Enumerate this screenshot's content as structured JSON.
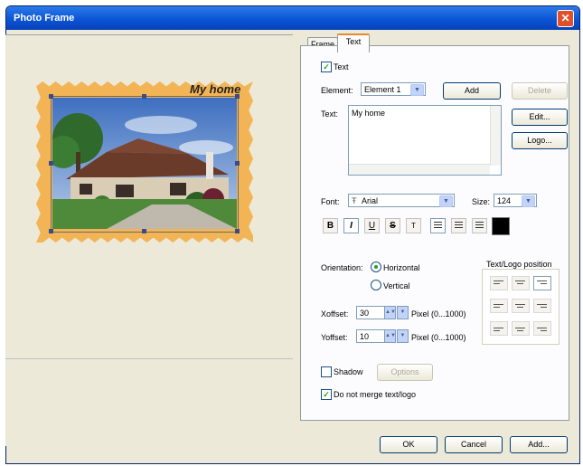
{
  "window": {
    "title": "Photo Frame"
  },
  "tabs": [
    {
      "label": "Frame"
    },
    {
      "label": "Text"
    }
  ],
  "text_tab": {
    "text_checkbox": "Text",
    "element_label": "Element:",
    "element_value": "Element 1",
    "add_label": "Add",
    "delete_label": "Delete",
    "text_label": "Text:",
    "text_value": "My home",
    "edit_label": "Edit...",
    "logo_label": "Logo...",
    "font_label": "Font:",
    "font_value": "Arial",
    "size_label": "Size:",
    "size_value": "124",
    "format_buttons": [
      "B",
      "I",
      "U",
      "S",
      "T"
    ],
    "text_color": "#000000",
    "orientation_label": "Orientation:",
    "horizontal_label": "Horizontal",
    "vertical_label": "Vertical",
    "position_label": "Text/Logo position",
    "xoffset_label": "Xoffset:",
    "xoffset_value": "30",
    "xoffset_unit": "Pixel (0...1000)",
    "yoffset_label": "Yoffset:",
    "yoffset_value": "10",
    "yoffset_unit": "Pixel (0...1000)",
    "shadow_label": "Shadow",
    "options_label": "Options",
    "no_merge_label": "Do not merge text/logo"
  },
  "preview": {
    "caption": "My home",
    "frame_color": "#f2b455"
  },
  "footer": {
    "ok_label": "OK",
    "cancel_label": "Cancel",
    "add_label": "Add..."
  }
}
